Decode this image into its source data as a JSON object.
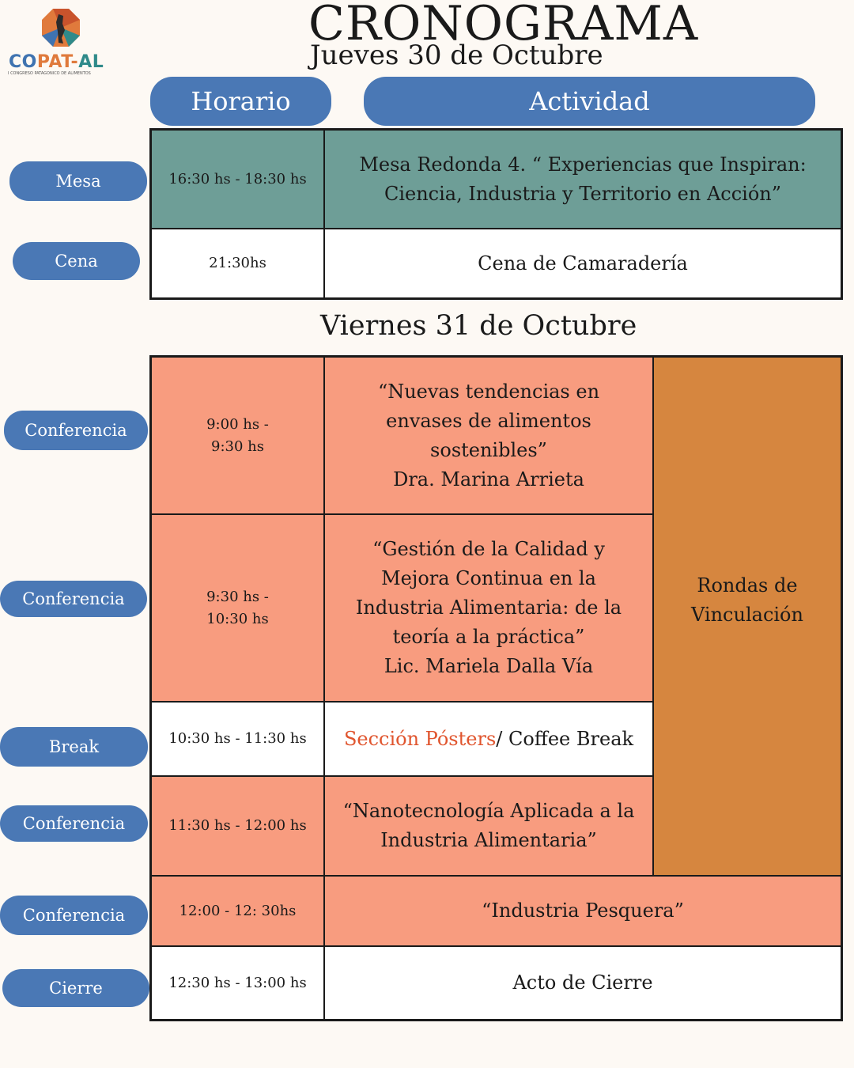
{
  "logo": {
    "name_co": "CO",
    "name_pat": "PAT-",
    "name_al": "AL",
    "subtitle": "I CONGRESO PATAGONICO DE ALIMENTOS"
  },
  "title": "CRONOGRAMA",
  "day1": {
    "label": "Jueves 30 de Octubre",
    "headers": {
      "time": "Horario",
      "activity": "Actividad"
    },
    "rows": [
      {
        "tag": "Mesa",
        "time": "16:30 hs - 18:30 hs",
        "activity_line1": "Mesa Redonda 4. “ Experiencias que Inspiran:",
        "activity_line2": "Ciencia, Industria y Territorio en Acción”"
      },
      {
        "tag": "Cena",
        "time": "21:30hs",
        "activity": "Cena de Camaradería"
      }
    ]
  },
  "day2": {
    "label": "Viernes 31 de Octubre",
    "side_activity_line1": "Rondas de",
    "side_activity_line2": "Vinculación",
    "rows": [
      {
        "tag": "Conferencia",
        "time_line1": "9:00 hs -",
        "time_line2": "9:30 hs",
        "lines": [
          "“Nuevas tendencias en",
          "envases de alimentos",
          "sostenibles”",
          "Dra. Marina Arrieta"
        ]
      },
      {
        "tag": "Conferencia",
        "time_line1": "9:30 hs -",
        "time_line2": "10:30 hs",
        "lines": [
          "“Gestión de la Calidad y",
          "Mejora Continua en la",
          "Industria Alimentaria: de la",
          "teoría a la práctica”",
          "Lic. Mariela Dalla Vía"
        ]
      },
      {
        "tag": "Break",
        "time": "10:30 hs - 11:30 hs",
        "activity_highlight": "Sección Pósters",
        "activity_rest": "/ Coffee Break"
      },
      {
        "tag": "Conferencia",
        "time": "11:30 hs - 12:00 hs",
        "lines": [
          "“Nanotecnología Aplicada a la",
          "Industria Alimentaria”"
        ]
      },
      {
        "tag": "Conferencia",
        "time": "12:00 - 12: 30hs",
        "activity": "“Industria Pesquera”"
      },
      {
        "tag": "Cierre",
        "time": "12:30 hs - 13:00 hs",
        "activity": "Acto de Cierre"
      }
    ]
  },
  "colors": {
    "pill_blue": "#4a78b5",
    "teal": "#6e9e97",
    "salmon": "#f89c7f",
    "orange": "#d6863f",
    "highlight": "#e0552e",
    "background": "#fdf9f4"
  }
}
